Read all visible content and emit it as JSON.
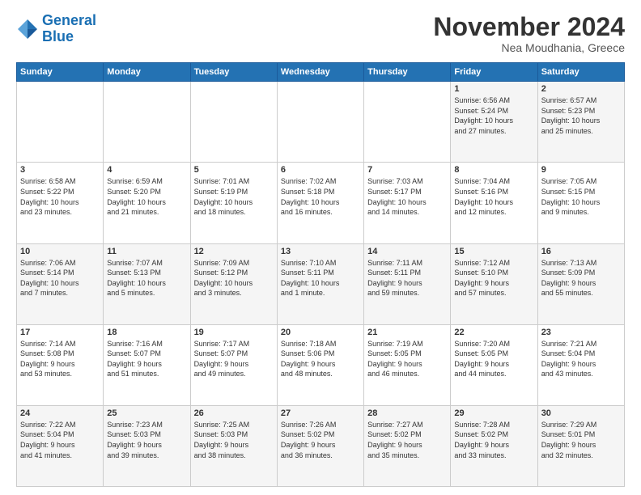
{
  "header": {
    "logo_line1": "General",
    "logo_line2": "Blue",
    "month": "November 2024",
    "location": "Nea Moudhania, Greece"
  },
  "weekdays": [
    "Sunday",
    "Monday",
    "Tuesday",
    "Wednesday",
    "Thursday",
    "Friday",
    "Saturday"
  ],
  "weeks": [
    [
      {
        "day": "",
        "info": ""
      },
      {
        "day": "",
        "info": ""
      },
      {
        "day": "",
        "info": ""
      },
      {
        "day": "",
        "info": ""
      },
      {
        "day": "",
        "info": ""
      },
      {
        "day": "1",
        "info": "Sunrise: 6:56 AM\nSunset: 5:24 PM\nDaylight: 10 hours\nand 27 minutes."
      },
      {
        "day": "2",
        "info": "Sunrise: 6:57 AM\nSunset: 5:23 PM\nDaylight: 10 hours\nand 25 minutes."
      }
    ],
    [
      {
        "day": "3",
        "info": "Sunrise: 6:58 AM\nSunset: 5:22 PM\nDaylight: 10 hours\nand 23 minutes."
      },
      {
        "day": "4",
        "info": "Sunrise: 6:59 AM\nSunset: 5:20 PM\nDaylight: 10 hours\nand 21 minutes."
      },
      {
        "day": "5",
        "info": "Sunrise: 7:01 AM\nSunset: 5:19 PM\nDaylight: 10 hours\nand 18 minutes."
      },
      {
        "day": "6",
        "info": "Sunrise: 7:02 AM\nSunset: 5:18 PM\nDaylight: 10 hours\nand 16 minutes."
      },
      {
        "day": "7",
        "info": "Sunrise: 7:03 AM\nSunset: 5:17 PM\nDaylight: 10 hours\nand 14 minutes."
      },
      {
        "day": "8",
        "info": "Sunrise: 7:04 AM\nSunset: 5:16 PM\nDaylight: 10 hours\nand 12 minutes."
      },
      {
        "day": "9",
        "info": "Sunrise: 7:05 AM\nSunset: 5:15 PM\nDaylight: 10 hours\nand 9 minutes."
      }
    ],
    [
      {
        "day": "10",
        "info": "Sunrise: 7:06 AM\nSunset: 5:14 PM\nDaylight: 10 hours\nand 7 minutes."
      },
      {
        "day": "11",
        "info": "Sunrise: 7:07 AM\nSunset: 5:13 PM\nDaylight: 10 hours\nand 5 minutes."
      },
      {
        "day": "12",
        "info": "Sunrise: 7:09 AM\nSunset: 5:12 PM\nDaylight: 10 hours\nand 3 minutes."
      },
      {
        "day": "13",
        "info": "Sunrise: 7:10 AM\nSunset: 5:11 PM\nDaylight: 10 hours\nand 1 minute."
      },
      {
        "day": "14",
        "info": "Sunrise: 7:11 AM\nSunset: 5:11 PM\nDaylight: 9 hours\nand 59 minutes."
      },
      {
        "day": "15",
        "info": "Sunrise: 7:12 AM\nSunset: 5:10 PM\nDaylight: 9 hours\nand 57 minutes."
      },
      {
        "day": "16",
        "info": "Sunrise: 7:13 AM\nSunset: 5:09 PM\nDaylight: 9 hours\nand 55 minutes."
      }
    ],
    [
      {
        "day": "17",
        "info": "Sunrise: 7:14 AM\nSunset: 5:08 PM\nDaylight: 9 hours\nand 53 minutes."
      },
      {
        "day": "18",
        "info": "Sunrise: 7:16 AM\nSunset: 5:07 PM\nDaylight: 9 hours\nand 51 minutes."
      },
      {
        "day": "19",
        "info": "Sunrise: 7:17 AM\nSunset: 5:07 PM\nDaylight: 9 hours\nand 49 minutes."
      },
      {
        "day": "20",
        "info": "Sunrise: 7:18 AM\nSunset: 5:06 PM\nDaylight: 9 hours\nand 48 minutes."
      },
      {
        "day": "21",
        "info": "Sunrise: 7:19 AM\nSunset: 5:05 PM\nDaylight: 9 hours\nand 46 minutes."
      },
      {
        "day": "22",
        "info": "Sunrise: 7:20 AM\nSunset: 5:05 PM\nDaylight: 9 hours\nand 44 minutes."
      },
      {
        "day": "23",
        "info": "Sunrise: 7:21 AM\nSunset: 5:04 PM\nDaylight: 9 hours\nand 43 minutes."
      }
    ],
    [
      {
        "day": "24",
        "info": "Sunrise: 7:22 AM\nSunset: 5:04 PM\nDaylight: 9 hours\nand 41 minutes."
      },
      {
        "day": "25",
        "info": "Sunrise: 7:23 AM\nSunset: 5:03 PM\nDaylight: 9 hours\nand 39 minutes."
      },
      {
        "day": "26",
        "info": "Sunrise: 7:25 AM\nSunset: 5:03 PM\nDaylight: 9 hours\nand 38 minutes."
      },
      {
        "day": "27",
        "info": "Sunrise: 7:26 AM\nSunset: 5:02 PM\nDaylight: 9 hours\nand 36 minutes."
      },
      {
        "day": "28",
        "info": "Sunrise: 7:27 AM\nSunset: 5:02 PM\nDaylight: 9 hours\nand 35 minutes."
      },
      {
        "day": "29",
        "info": "Sunrise: 7:28 AM\nSunset: 5:02 PM\nDaylight: 9 hours\nand 33 minutes."
      },
      {
        "day": "30",
        "info": "Sunrise: 7:29 AM\nSunset: 5:01 PM\nDaylight: 9 hours\nand 32 minutes."
      }
    ]
  ]
}
